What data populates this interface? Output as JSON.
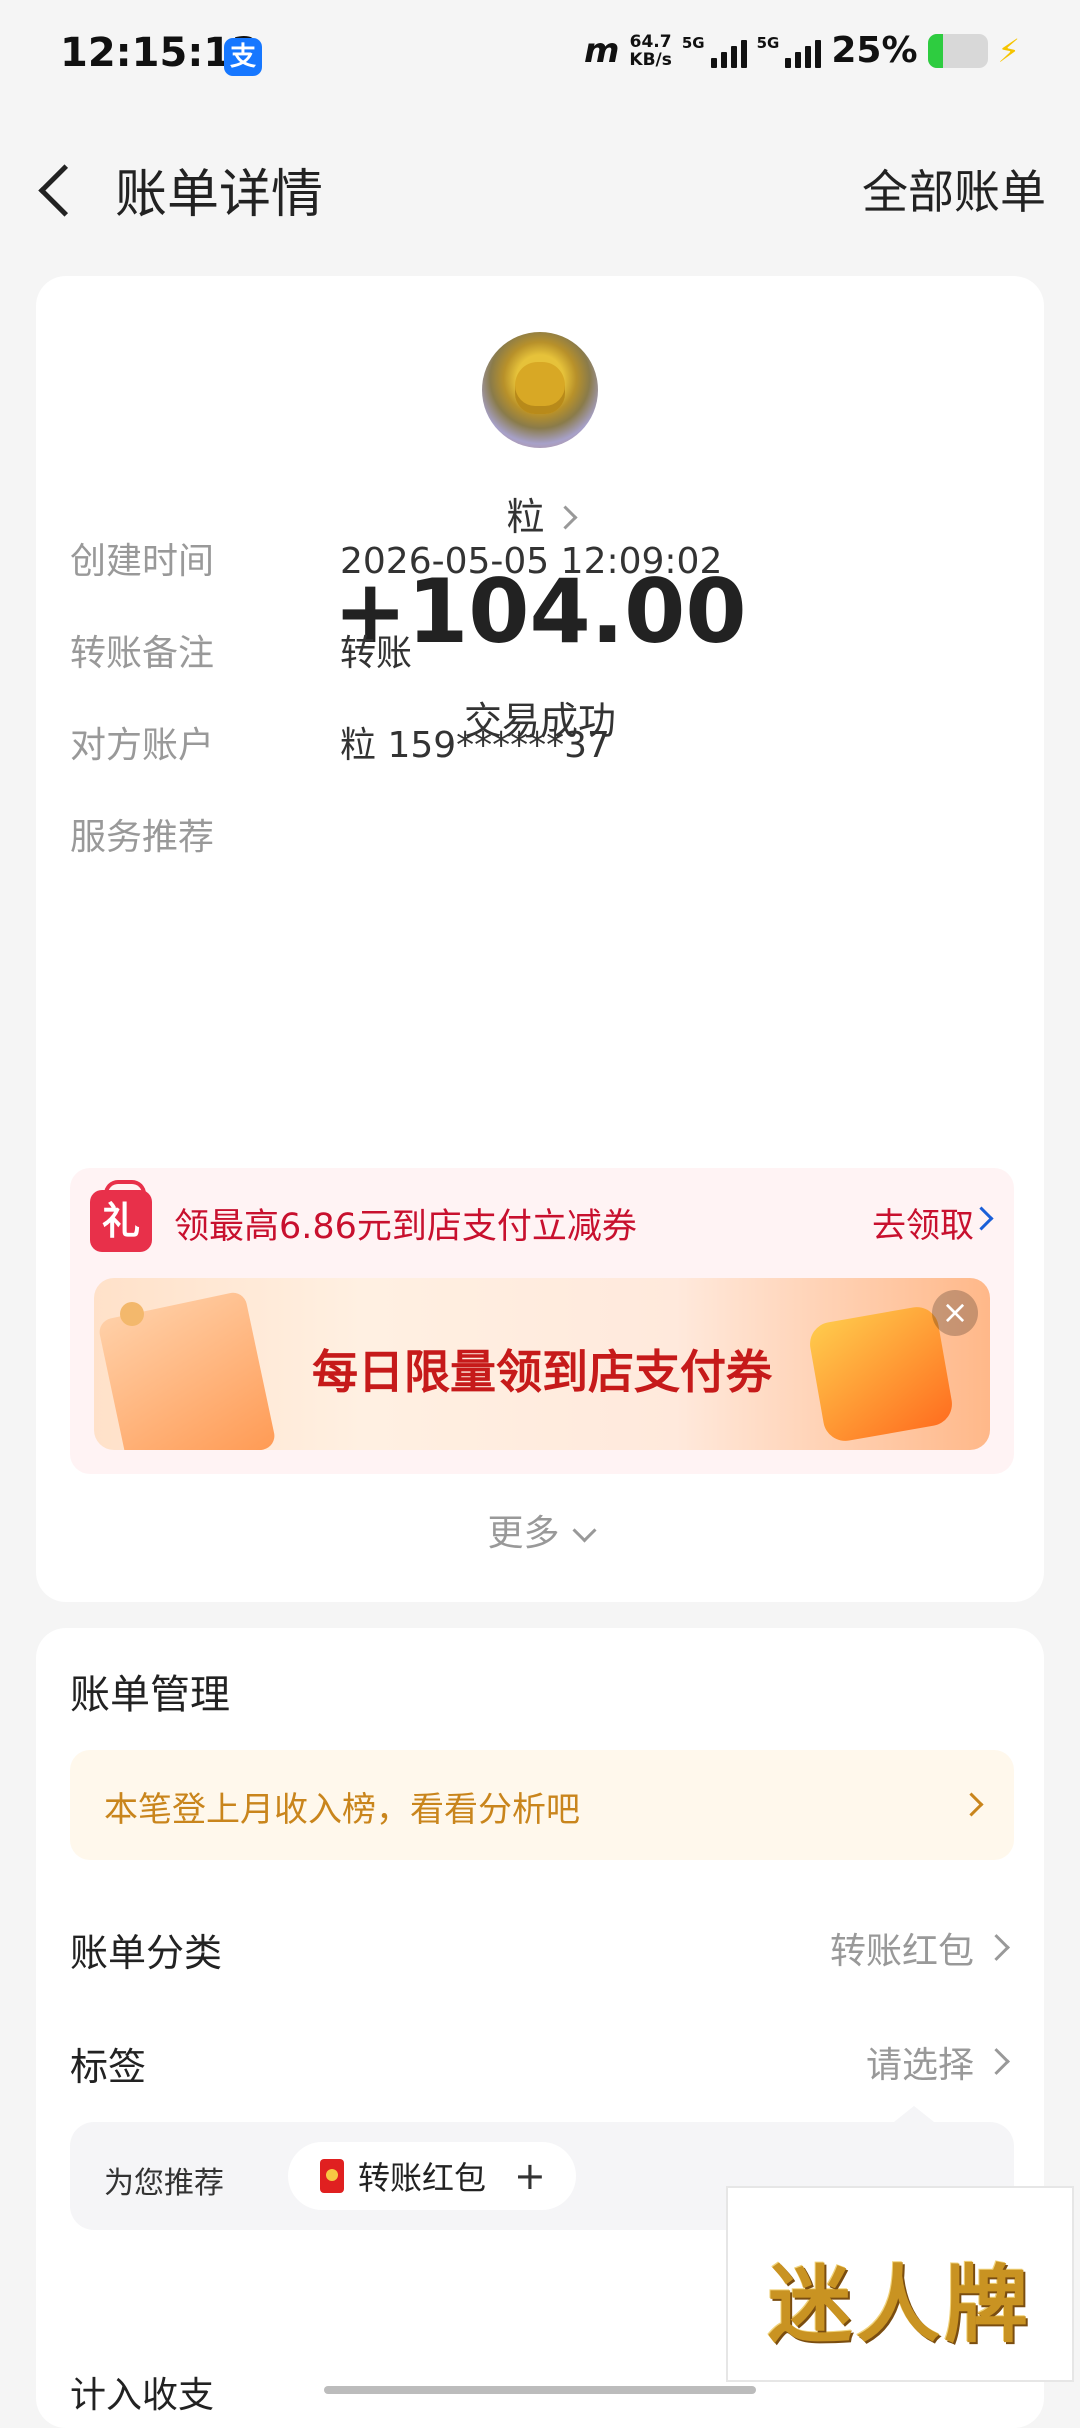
{
  "status_bar": {
    "time": "12:15:13",
    "alipay_badge": "支",
    "speed_top": "64.7",
    "speed_unit": "KB/s",
    "signal_label_1": "5G",
    "signal_label_2": "5G",
    "battery_percent": "25%",
    "battery_level": 0.25,
    "network_glyph": "m"
  },
  "nav": {
    "title": "账单详情",
    "right_action": "全部账单"
  },
  "transaction": {
    "payee": "粒",
    "amount": "+104.00",
    "status": "交易成功",
    "details": [
      {
        "label": "创建时间",
        "value": "2026-05-05 12:09:02"
      },
      {
        "label": "转账备注",
        "value": "转账"
      },
      {
        "label": "对方账户",
        "value": "粒 159******37"
      },
      {
        "label": "服务推荐",
        "value": ""
      }
    ]
  },
  "promo": {
    "gift_icon_text": "礼",
    "text": "领最高6.86元到店支付立减券",
    "action": "去领取",
    "banner_text": "每日限量领到店支付券",
    "close_symbol": "×"
  },
  "more_label": "更多",
  "management": {
    "title": "账单管理",
    "tip": "本笔登上月收入榜，看看分析吧",
    "category_label": "账单分类",
    "category_value": "转账红包",
    "tag_label": "标签",
    "tag_value": "请选择",
    "recommend_label": "为您推荐",
    "recommend_chip": "转账红包",
    "chip_plus": "+",
    "income_label": "计入收支"
  },
  "watermark_text": "迷人牌",
  "colors": {
    "accent_red": "#c8102e",
    "tip_orange": "#c9851c",
    "background": "#f5f5f5"
  }
}
